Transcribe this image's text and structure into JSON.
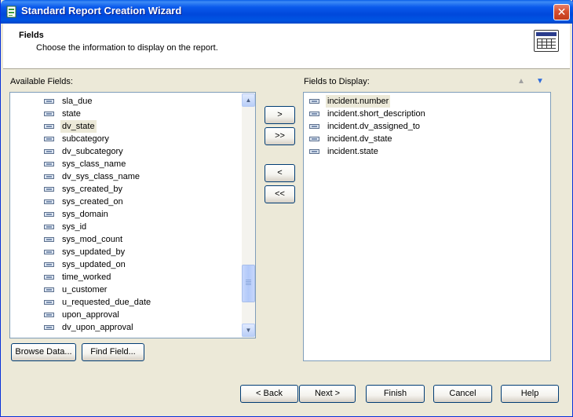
{
  "window": {
    "title": "Standard Report Creation Wizard"
  },
  "header": {
    "title": "Fields",
    "subtitle": "Choose the information to display on the report."
  },
  "available": {
    "label": "Available Fields:",
    "items": [
      "sla_due",
      "state",
      "dv_state",
      "subcategory",
      "dv_subcategory",
      "sys_class_name",
      "dv_sys_class_name",
      "sys_created_by",
      "sys_created_on",
      "sys_domain",
      "sys_id",
      "sys_mod_count",
      "sys_updated_by",
      "sys_updated_on",
      "time_worked",
      "u_customer",
      "u_requested_due_date",
      "upon_approval",
      "dv_upon_approval"
    ],
    "selected": "dv_state"
  },
  "display": {
    "label": "Fields to Display:",
    "items": [
      "incident.number",
      "incident.short_description",
      "incident.dv_assigned_to",
      "incident.dv_state",
      "incident.state"
    ],
    "selected": "incident.number"
  },
  "transfer": {
    "add": ">",
    "add_all": ">>",
    "remove": "<",
    "remove_all": "<<"
  },
  "list_buttons": {
    "browse": "Browse Data...",
    "find": "Find Field..."
  },
  "footer": {
    "back": "< Back",
    "next": "Next >",
    "finish": "Finish",
    "cancel": "Cancel",
    "help": "Help"
  },
  "colors": {
    "title_bar": "#0054E3",
    "window_bg": "#ECE9D8",
    "close": "#D6502F"
  }
}
